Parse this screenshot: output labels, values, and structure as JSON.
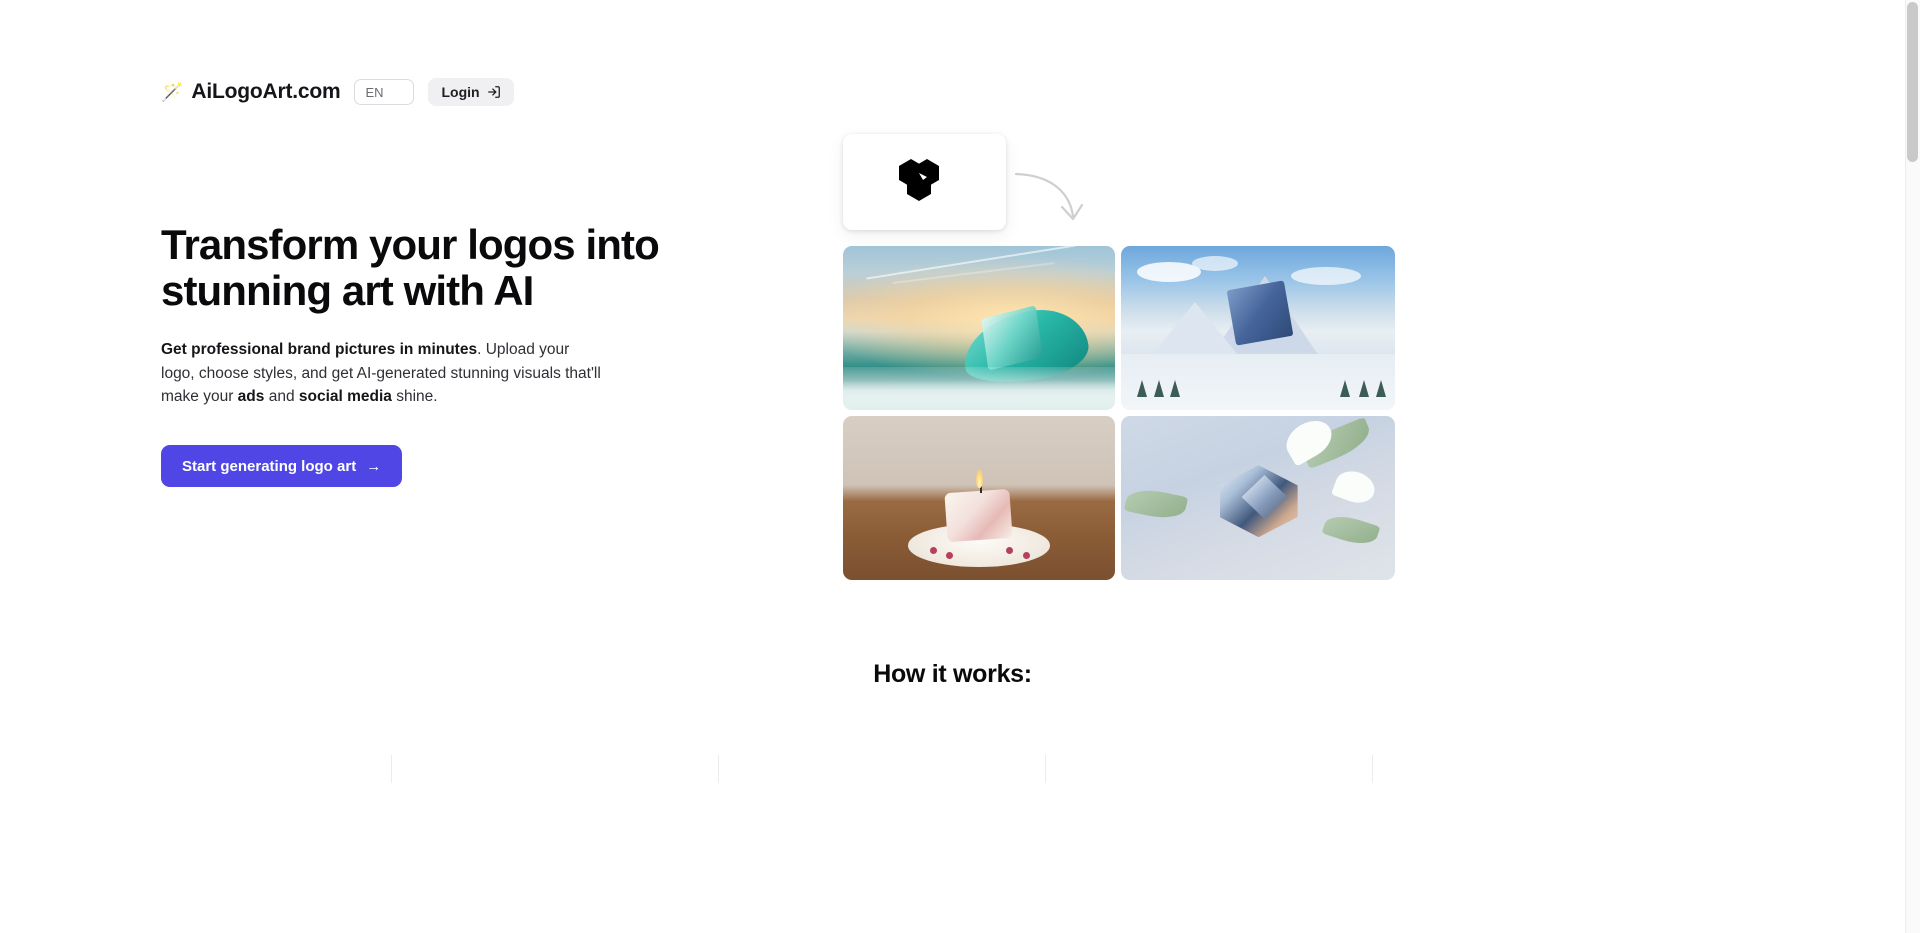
{
  "header": {
    "wand_icon": "magic-wand",
    "brand_name": "AiLogoArt.com",
    "language_value": "EN",
    "login_label": "Login",
    "login_icon": "login-arrow-icon"
  },
  "hero": {
    "title": "Transform your logos into stunning art with AI",
    "subtitle": {
      "bold_lead": "Get professional brand pictures in minutes",
      "after_lead": ". Upload your logo, choose styles, and get AI-generated stunning visuals that'll make your ",
      "bold_ads": "ads",
      "between": " and ",
      "bold_social": "social media",
      "tail": " shine."
    },
    "cta_label": "Start generating logo art",
    "cta_arrow": "→",
    "cta_color": "#4f46e5"
  },
  "showcase": {
    "logo_card_alt": "black geometric cube logo",
    "arrow_alt": "curved arrow pointing to generated art",
    "tiles": [
      {
        "name": "ocean-wave-sunset",
        "alt": "Logo cube riding a turquoise ocean wave at sunset"
      },
      {
        "name": "snowy-mountain",
        "alt": "Logo cube as a blue crystal peak in snowy mountains"
      },
      {
        "name": "candle-on-plate",
        "alt": "Logo cube as a lit candle on a plate with berries"
      },
      {
        "name": "crystal-flowers",
        "alt": "Logo cube as a faceted crystal gem among white flowers"
      }
    ]
  },
  "how_it_works": {
    "title": "How it works:"
  },
  "scrollbar": {
    "name": "vertical-scrollbar"
  }
}
